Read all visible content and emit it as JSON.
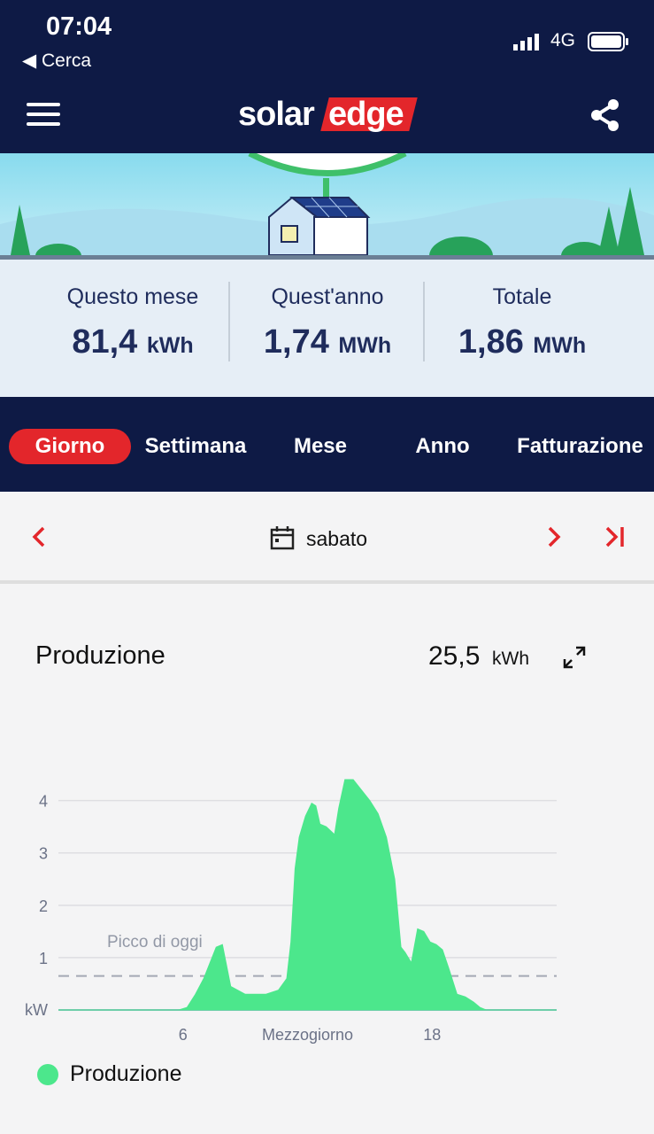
{
  "status_bar": {
    "time": "07:04",
    "back_label": "◀ Cerca",
    "network": "4G"
  },
  "app_bar": {
    "logo_left": "solar",
    "logo_right": "edge"
  },
  "summary": [
    {
      "label": "Questo mese",
      "value": "81,4",
      "unit": "kWh"
    },
    {
      "label": "Quest'anno",
      "value": "1,74",
      "unit": "MWh"
    },
    {
      "label": "Totale",
      "value": "1,86",
      "unit": "MWh"
    }
  ],
  "tabs": [
    {
      "label": "Giorno",
      "active": true
    },
    {
      "label": "Settimana",
      "active": false
    },
    {
      "label": "Mese",
      "active": false
    },
    {
      "label": "Anno",
      "active": false
    },
    {
      "label": "Fatturazione",
      "active": false
    }
  ],
  "date_nav": {
    "label": "sabato"
  },
  "card": {
    "title": "Produzione",
    "total": "25,5",
    "unit": "kWh"
  },
  "colors": {
    "navy": "#0e1a45",
    "accent": "#e3262b",
    "series": "#4ce78c"
  },
  "icons": [
    "menu-icon",
    "share-icon",
    "calendar-icon",
    "chevron-left-icon",
    "chevron-right-icon",
    "skip-to-last-icon",
    "expand-icon"
  ],
  "chart_data": {
    "type": "area",
    "title": "",
    "ylabel": "kW",
    "ylim": [
      0,
      4.4
    ],
    "xlim": [
      0,
      24
    ],
    "yticks": [
      1,
      2,
      3,
      4
    ],
    "xticks": [
      {
        "value": 6,
        "label": "6"
      },
      {
        "value": 12,
        "label": "Mezzogiorno"
      },
      {
        "value": 18,
        "label": "18"
      }
    ],
    "grid": true,
    "reference_line": {
      "label": "Picco di oggi",
      "y": 0.65
    },
    "legend": {
      "position": "bottom-left",
      "entries": [
        "Produzione"
      ]
    },
    "series": [
      {
        "name": "Produzione",
        "color": "#4ce78c",
        "x": [
          0,
          5.8,
          6.2,
          6.6,
          7.0,
          7.3,
          7.6,
          7.9,
          8.3,
          9,
          10,
          10.6,
          11.0,
          11.2,
          11.4,
          11.6,
          11.9,
          12.2,
          12.4,
          12.6,
          12.9,
          13.3,
          13.5,
          13.8,
          14.2,
          14.6,
          15.0,
          15.4,
          15.8,
          16.2,
          16.5,
          16.7,
          17.0,
          17.3,
          17.6,
          17.9,
          18.2,
          18.5,
          18.8,
          19.2,
          19.6,
          20.0,
          20.3,
          20.6,
          24
        ],
        "y": [
          0,
          0,
          0.05,
          0.3,
          0.6,
          0.9,
          1.2,
          1.25,
          0.45,
          0.3,
          0.3,
          0.38,
          0.6,
          1.3,
          2.7,
          3.3,
          3.7,
          3.95,
          3.9,
          3.55,
          3.5,
          3.35,
          3.85,
          4.4,
          4.4,
          4.2,
          4.0,
          3.75,
          3.3,
          2.5,
          1.2,
          1.1,
          0.9,
          1.55,
          1.5,
          1.3,
          1.25,
          1.15,
          0.8,
          0.3,
          0.25,
          0.15,
          0.05,
          0,
          0
        ]
      }
    ]
  }
}
